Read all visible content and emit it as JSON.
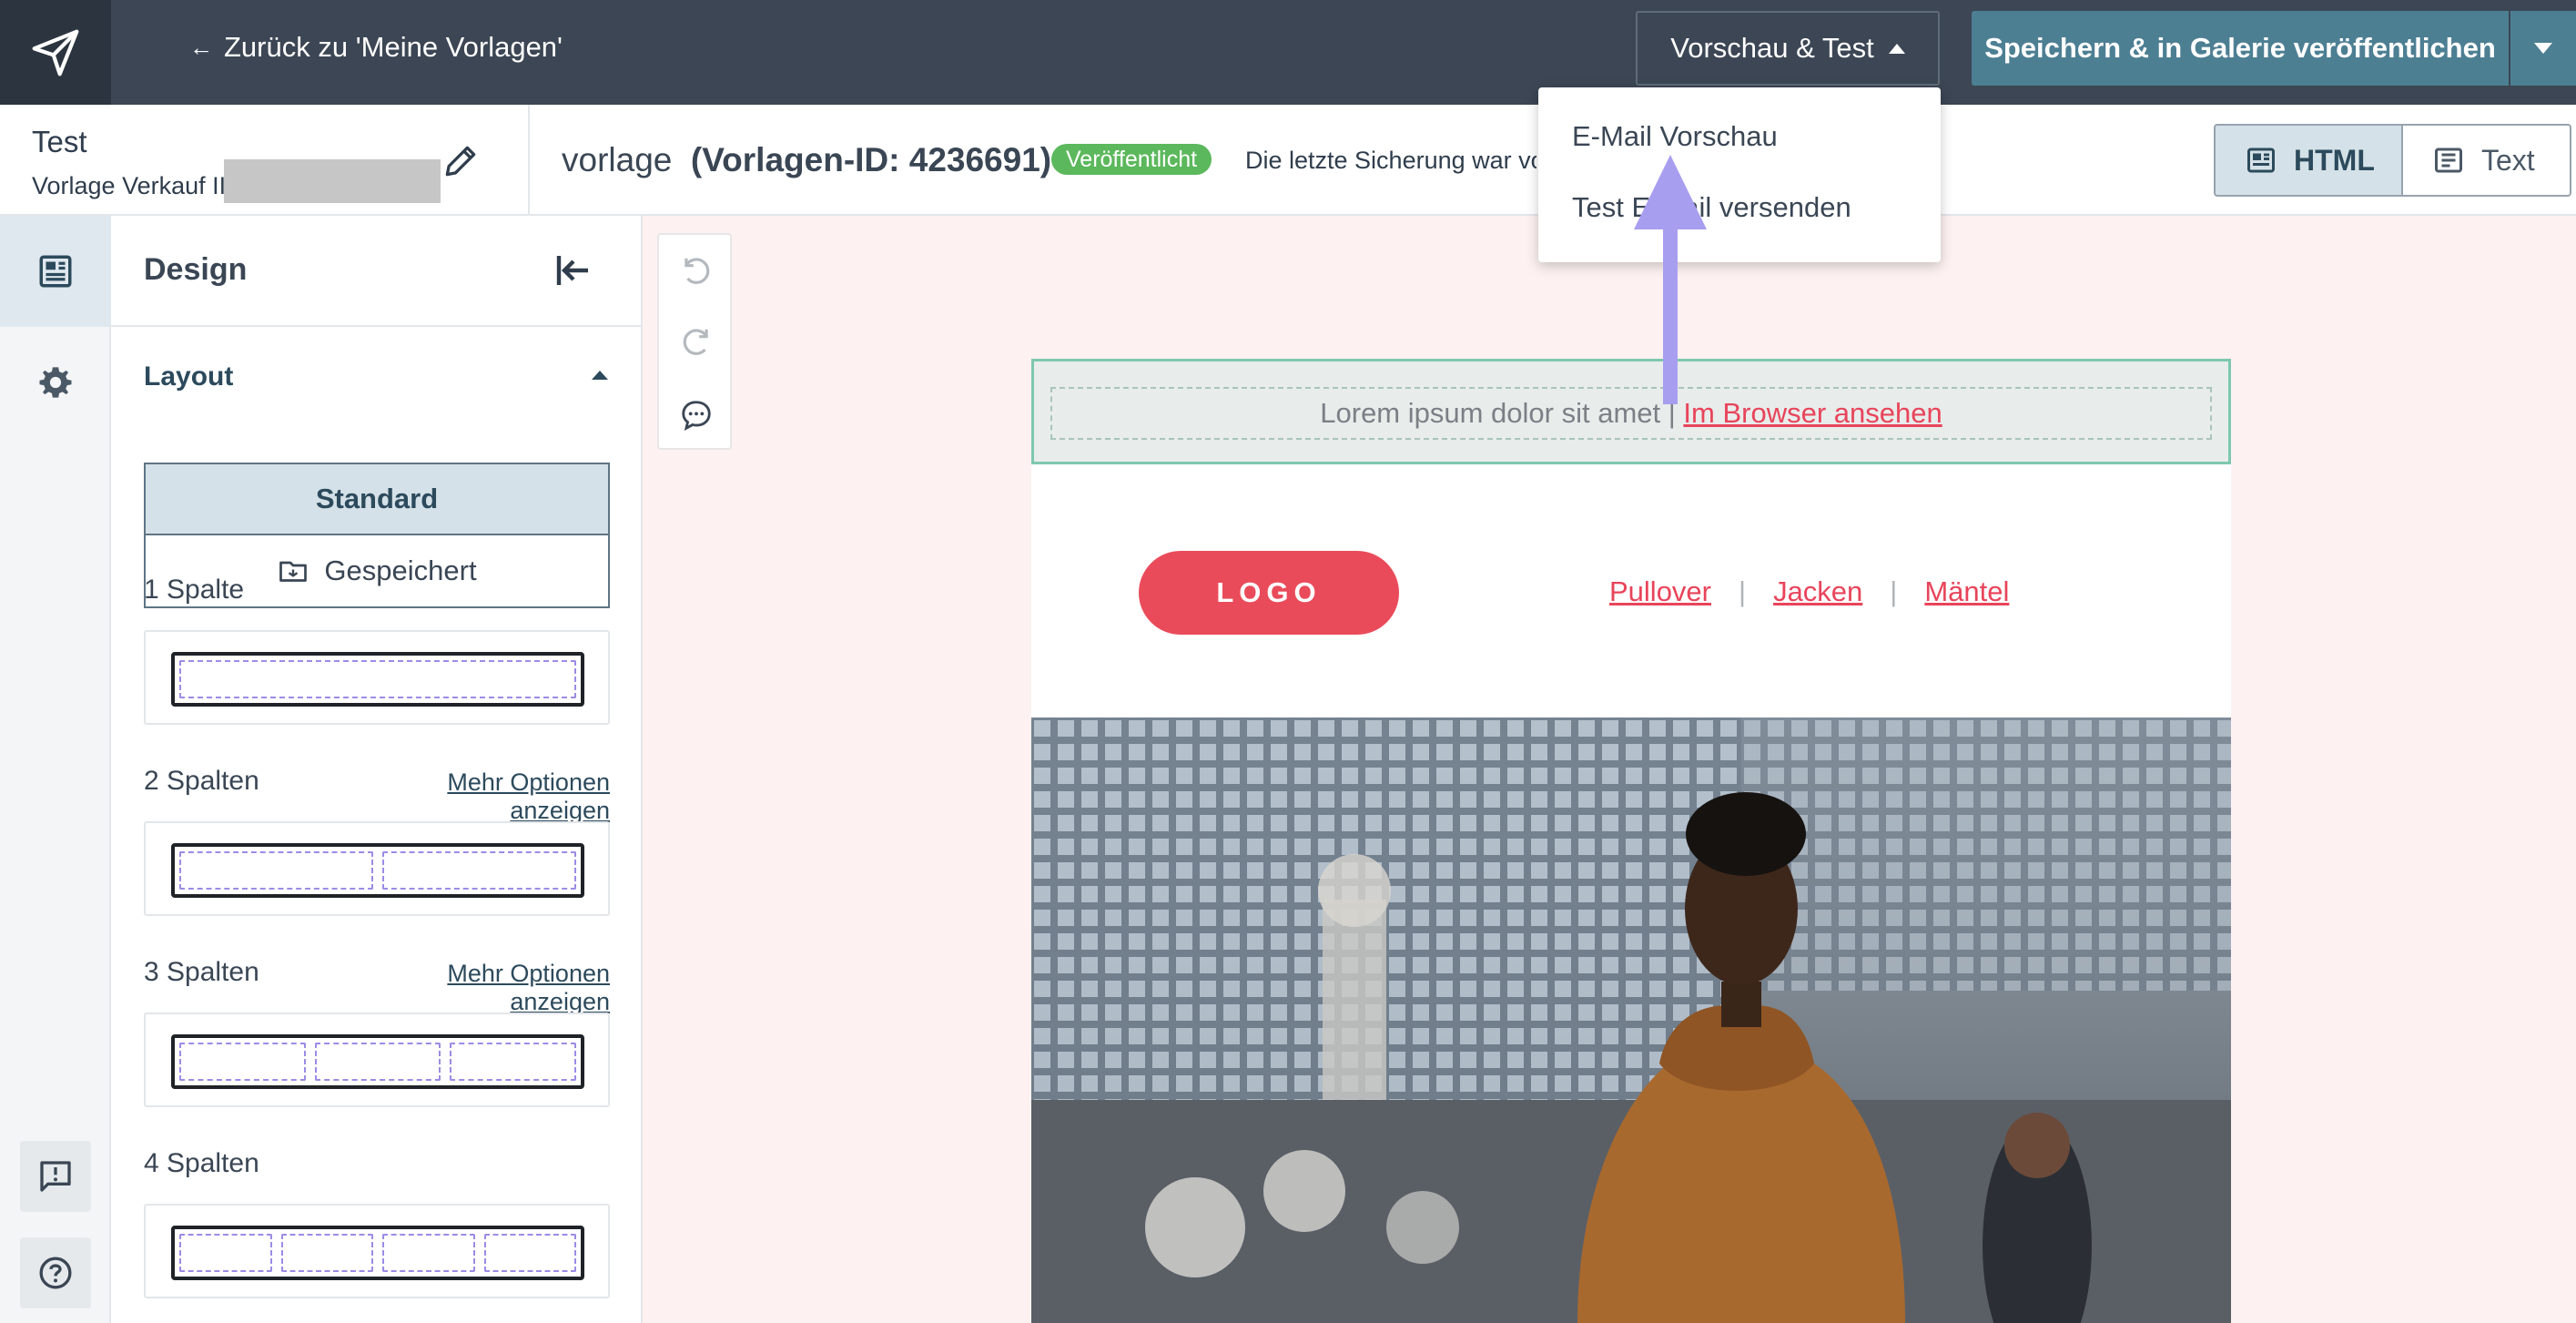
{
  "topbar": {
    "back_label": "Zurück zu 'Meine Vorlagen'",
    "preview_label": "Vorschau & Test",
    "save_label": "Speichern & in Galerie veröffentlichen"
  },
  "dropdown": {
    "items": [
      "E-Mail Vorschau",
      "Test E-Mail versenden"
    ]
  },
  "header": {
    "template_name": "Test",
    "template_sub": "Vorlage Verkauf II",
    "vorlage_name": "vorlage",
    "vorlage_id": "(Vorlagen-ID: 4236691)",
    "status_badge": "Veröffentlicht",
    "save_info": "Die letzte Sicherung war vor",
    "view_html": "HTML",
    "view_text": "Text"
  },
  "panel": {
    "title": "Design",
    "layout_heading": "Layout",
    "seg_standard": "Standard",
    "seg_saved": "Gespeichert",
    "columns": [
      {
        "label": "1 Spalte",
        "more": "",
        "count": 1
      },
      {
        "label": "2 Spalten",
        "more": "Mehr Optionen anzeigen",
        "count": 2
      },
      {
        "label": "3 Spalten",
        "more": "Mehr Optionen anzeigen",
        "count": 3
      },
      {
        "label": "4 Spalten",
        "more": "",
        "count": 4
      }
    ]
  },
  "email": {
    "preheader_text": "Lorem ipsum dolor sit amet | ",
    "preheader_link": "Im Browser ansehen",
    "logo_text": "LOGO",
    "nav": [
      "Pullover",
      "Jacken",
      "Mäntel"
    ],
    "nav_separator": "|"
  },
  "colors": {
    "topbar": "#3c4654",
    "accent": "#4d7f93",
    "brand_red": "#ea4b5a",
    "badge_green": "#5cb85c",
    "arrow": "#a89ef0"
  },
  "icons": [
    "send-logo-icon",
    "arrow-left-icon",
    "pencil-icon",
    "html-icon",
    "text-icon",
    "design-icon",
    "gear-icon",
    "feedback-icon",
    "help-icon",
    "collapse-left-icon",
    "folder-icon",
    "undo-icon",
    "redo-icon",
    "comment-icon"
  ]
}
